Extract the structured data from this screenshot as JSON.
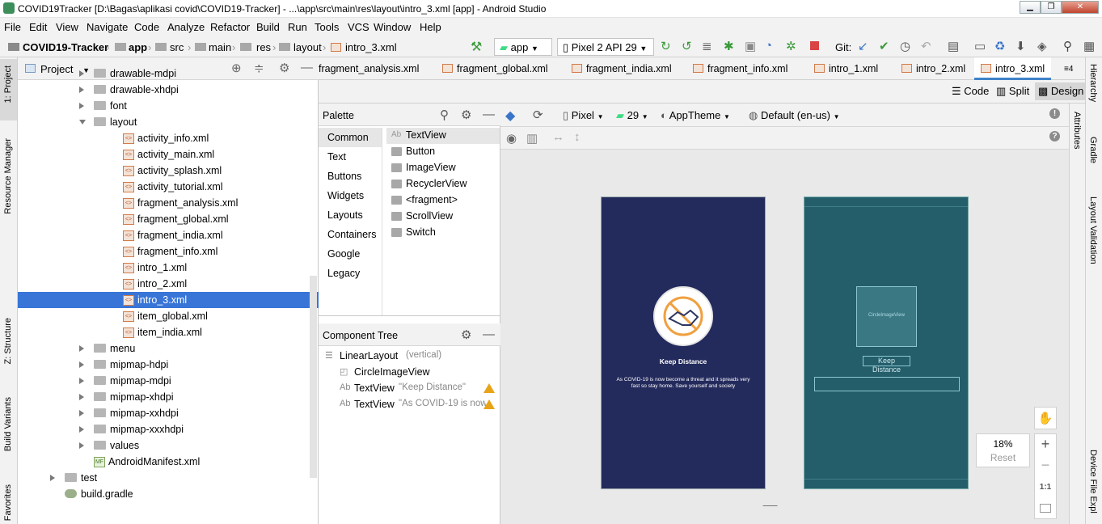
{
  "window": {
    "title": "COVID19Tracker [D:\\Bagas\\aplikasi covid\\COVID19-Tracker] - ...\\app\\src\\main\\res\\layout\\intro_3.xml [app] - Android Studio"
  },
  "menu": [
    "File",
    "Edit",
    "View",
    "Navigate",
    "Code",
    "Analyze",
    "Refactor",
    "Build",
    "Run",
    "Tools",
    "VCS",
    "Window",
    "Help"
  ],
  "breadcrumb": [
    "COVID19-Tracker",
    "app",
    "src",
    "main",
    "res",
    "layout",
    "intro_3.xml"
  ],
  "toolbar": {
    "run_config": "app",
    "device": "Pixel 2 API 29",
    "git_label": "Git:"
  },
  "left_tools": {
    "project": "1: Project",
    "resource_manager": "Resource Manager",
    "structure": "Z: Structure",
    "build_variants": "Build Variants",
    "favorites": "Favorites"
  },
  "project_panel": {
    "title": "Project",
    "rows": [
      {
        "label": "drawable-mdpi",
        "type": "folder"
      },
      {
        "label": "drawable-xhdpi",
        "type": "folder"
      },
      {
        "label": "font",
        "type": "folder"
      },
      {
        "label": "layout",
        "type": "folder-open"
      },
      {
        "label": "activity_info.xml",
        "type": "xml"
      },
      {
        "label": "activity_main.xml",
        "type": "xml"
      },
      {
        "label": "activity_splash.xml",
        "type": "xml"
      },
      {
        "label": "activity_tutorial.xml",
        "type": "xml"
      },
      {
        "label": "fragment_analysis.xml",
        "type": "xml"
      },
      {
        "label": "fragment_global.xml",
        "type": "xml"
      },
      {
        "label": "fragment_india.xml",
        "type": "xml"
      },
      {
        "label": "fragment_info.xml",
        "type": "xml"
      },
      {
        "label": "intro_1.xml",
        "type": "xml"
      },
      {
        "label": "intro_2.xml",
        "type": "xml"
      },
      {
        "label": "intro_3.xml",
        "type": "xml",
        "selected": true
      },
      {
        "label": "item_global.xml",
        "type": "xml"
      },
      {
        "label": "item_india.xml",
        "type": "xml"
      },
      {
        "label": "menu",
        "type": "folder"
      },
      {
        "label": "mipmap-hdpi",
        "type": "folder"
      },
      {
        "label": "mipmap-mdpi",
        "type": "folder"
      },
      {
        "label": "mipmap-xhdpi",
        "type": "folder"
      },
      {
        "label": "mipmap-xxhdpi",
        "type": "folder"
      },
      {
        "label": "mipmap-xxxhdpi",
        "type": "folder"
      },
      {
        "label": "values",
        "type": "folder"
      },
      {
        "label": "AndroidManifest.xml",
        "type": "manifest"
      },
      {
        "label": "test",
        "type": "folder"
      },
      {
        "label": "build.gradle",
        "type": "gradle"
      }
    ]
  },
  "tabs": [
    "fragment_analysis.xml",
    "fragment_global.xml",
    "fragment_india.xml",
    "fragment_info.xml",
    "intro_1.xml",
    "intro_2.xml",
    "intro_3.xml"
  ],
  "tab_overflow": "≡4",
  "view_modes": {
    "code": "Code",
    "split": "Split",
    "design": "Design"
  },
  "palette": {
    "title": "Palette",
    "categories": [
      "Common",
      "Text",
      "Buttons",
      "Widgets",
      "Layouts",
      "Containers",
      "Google",
      "Legacy"
    ],
    "items": [
      "TextView",
      "Button",
      "ImageView",
      "RecyclerView",
      "<fragment>",
      "ScrollView",
      "Switch"
    ]
  },
  "component_tree": {
    "title": "Component Tree",
    "rows": [
      {
        "name": "LinearLayout",
        "detail": "(vertical)"
      },
      {
        "name": "CircleImageView",
        "detail": ""
      },
      {
        "name": "TextView",
        "detail": "\"Keep Distance\"",
        "warn": true
      },
      {
        "name": "TextView",
        "detail": "\"As COVID-19 is now",
        "warn": true
      }
    ]
  },
  "design_toolbar": {
    "device": "Pixel",
    "api": "29",
    "theme": "AppTheme",
    "locale": "Default (en-us)"
  },
  "preview": {
    "heading": "Keep Distance",
    "body": "As COVID-19 is now become a threat and it spreads very fast so stay home. Save yourself and society",
    "blueprint_image": "CircleImageView",
    "blueprint_heading": "Keep Distance"
  },
  "zoom": {
    "level": "18%",
    "reset": "Reset",
    "one_to_one": "1:1"
  },
  "right_tools": {
    "attributes": "Attributes",
    "hierarchy": "Hierarchy",
    "gradle": "Gradle",
    "layout_validation": "Layout Validation",
    "device_file": "Device File Expl"
  },
  "colors": {
    "selection": "#3875d7",
    "preview_bg": "#232a5c",
    "blueprint_bg": "#245e6a",
    "accent": "#f0a040"
  }
}
